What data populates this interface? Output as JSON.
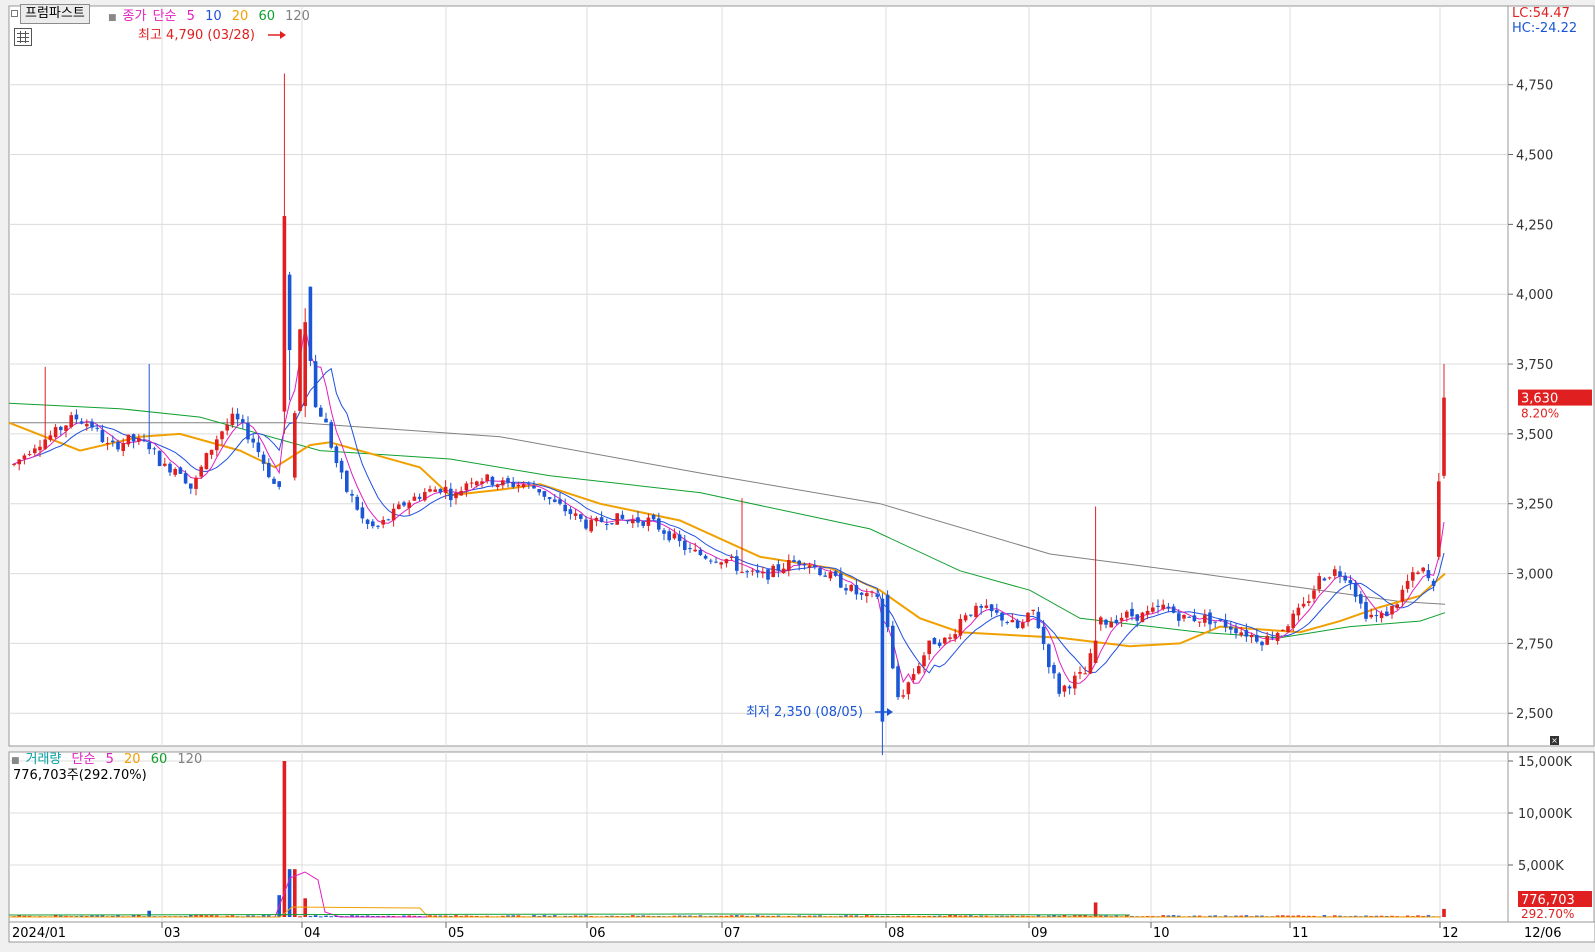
{
  "toolbar": {
    "button_label": "프럼파스트",
    "grid_icon": "table-grid-icon"
  },
  "price_legend": {
    "label1": "종가",
    "label2": "단순",
    "ma": [
      "5",
      "10",
      "20",
      "60",
      "120"
    ]
  },
  "volume_legend": {
    "label1": "거래량",
    "label2": "단순",
    "ma": [
      "5",
      "20",
      "60",
      "120"
    ],
    "current": "776,703주(292.70%)"
  },
  "top_right": {
    "lc": "LC:54.47",
    "hc": "HC:-24.22"
  },
  "price_badge": {
    "value": "3,630",
    "change": "8.20%"
  },
  "volume_badge": {
    "value": "776,703",
    "pct": "292.70%"
  },
  "annotations": {
    "high": "최고 4,790 (03/28)",
    "low": "최저 2,350 (08/05)"
  },
  "price_axis_labels": [
    "4,750",
    "4,500",
    "4,250",
    "4,000",
    "3,750",
    "3,500",
    "3,250",
    "3,000",
    "2,750",
    "2,500"
  ],
  "volume_axis_labels": [
    "15,000K",
    "10,000K",
    "5,000K"
  ],
  "x_labels": [
    "2024/01",
    "03",
    "04",
    "05",
    "06",
    "07",
    "08",
    "09",
    "10",
    "11",
    "12",
    "12/06"
  ],
  "colors": {
    "up": "#e02020",
    "down": "#1a56d6",
    "ma5": "#e020c0",
    "ma10": "#2050e0",
    "ma20": "#f0a000",
    "ma60": "#10a030",
    "ma120": "#808080"
  },
  "chart_data": {
    "type": "candlestick",
    "title": "",
    "period": "2024/01 - 2024/12/06",
    "price_range": [
      2350,
      4790
    ],
    "y_ticks": [
      2500,
      2750,
      3000,
      3250,
      3500,
      3750,
      4000,
      4250,
      4500,
      4750
    ],
    "volume_ticks_k": [
      5000,
      10000,
      15000
    ],
    "last_close": 3630,
    "change_pct": 8.2,
    "high": {
      "value": 4790,
      "date": "03/28"
    },
    "low": {
      "value": 2350,
      "date": "08/05"
    },
    "moving_averages": [
      5,
      10,
      20,
      60,
      120
    ],
    "volume_last": 776703,
    "volume_spike_k": 15000
  }
}
